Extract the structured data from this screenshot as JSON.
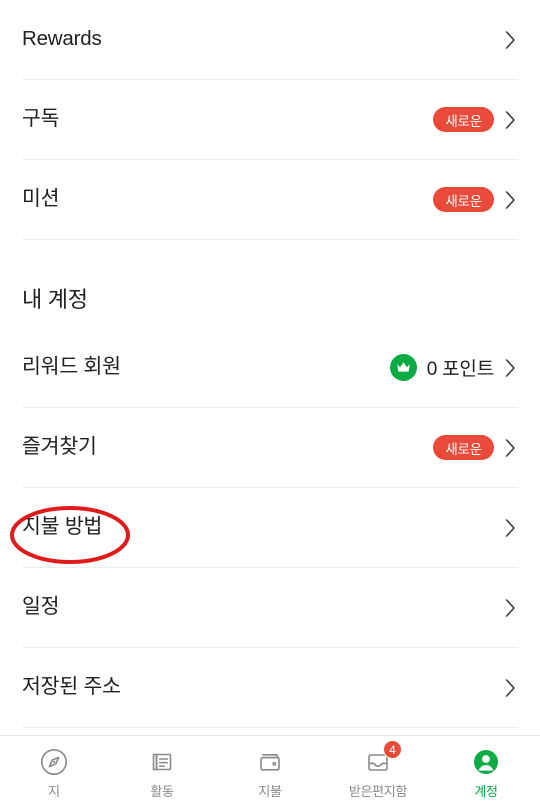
{
  "colors": {
    "badge_red": "#ea4a39",
    "brand_green": "#0cab45",
    "text_primary": "#202124",
    "text_muted": "#8a8a8a",
    "divider": "#eceded",
    "annotation_red": "#e01b1b"
  },
  "list": {
    "top_group": [
      {
        "label": "Rewards",
        "badge": "",
        "chevron": "chevron-right-icon"
      },
      {
        "label": "구독",
        "badge": "새로운",
        "chevron": "chevron-right-icon"
      },
      {
        "label": "미션",
        "badge": "새로운",
        "chevron": "chevron-right-icon"
      }
    ],
    "section": {
      "title": "내 계정"
    },
    "account_group": [
      {
        "label": "리워드 회원",
        "badge": "",
        "points": "0 포인트",
        "icon": "crown-icon",
        "chevron": "chevron-right-icon"
      },
      {
        "label": "즐겨찾기",
        "badge": "새로운",
        "points": "",
        "icon": "",
        "chevron": "chevron-right-icon"
      },
      {
        "label": "지불 방법",
        "badge": "",
        "points": "",
        "icon": "",
        "chevron": "chevron-right-icon"
      },
      {
        "label": "일정",
        "badge": "",
        "points": "",
        "icon": "",
        "chevron": "chevron-right-icon"
      },
      {
        "label": "저장된 주소",
        "badge": "",
        "points": "",
        "icon": "",
        "chevron": "chevron-right-icon"
      }
    ]
  },
  "annotation": {
    "target_row_label": "지불 방법",
    "shape": "ellipse",
    "color": "#e01b1b"
  },
  "tabbar": {
    "items": [
      {
        "label": "지",
        "icon": "compass-icon",
        "badge": "",
        "active": false
      },
      {
        "label": "활동",
        "icon": "activity-document-icon",
        "badge": "",
        "active": false
      },
      {
        "label": "지불",
        "icon": "wallet-icon",
        "badge": "",
        "active": false
      },
      {
        "label": "받은편지함",
        "icon": "inbox-icon",
        "badge": "4",
        "active": false
      },
      {
        "label": "계정",
        "icon": "account-person-icon",
        "badge": "",
        "active": true
      }
    ]
  }
}
